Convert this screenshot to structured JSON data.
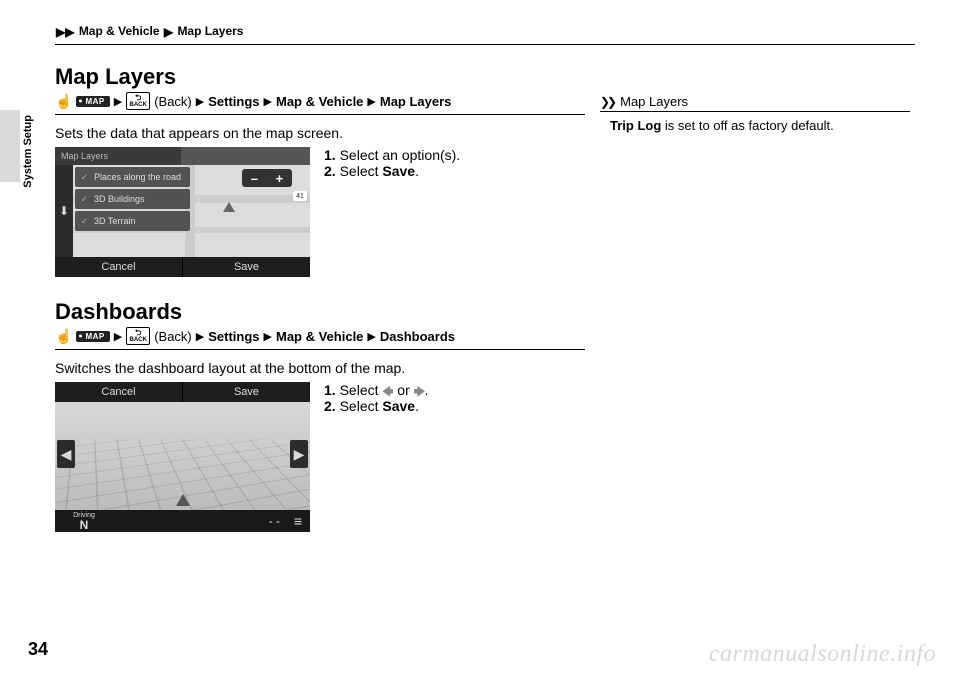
{
  "breadcrumb": {
    "part1": "Map & Vehicle",
    "part2": "Map Layers"
  },
  "side_tab": "System Setup",
  "section1": {
    "title": "Map Layers",
    "path": {
      "map": "MAP",
      "back": "BACK",
      "back_label": "(Back)",
      "p1": "Settings",
      "p2": "Map & Vehicle",
      "p3": "Map Layers"
    },
    "desc": "Sets the data that appears on the map screen.",
    "steps": {
      "s1": "Select an option(s).",
      "s2_a": "Select ",
      "s2_b": "Save",
      "s2_c": "."
    },
    "shot": {
      "header": "Map Layers",
      "items": [
        "Places along the road",
        "3D Buildings",
        "3D Terrain"
      ],
      "zoom_minus": "–",
      "zoom_plus": "+",
      "btn_cancel": "Cancel",
      "btn_save": "Save",
      "badge": "41"
    }
  },
  "section2": {
    "title": "Dashboards",
    "path": {
      "map": "MAP",
      "back": "BACK",
      "back_label": "(Back)",
      "p1": "Settings",
      "p2": "Map & Vehicle",
      "p3": "Dashboards"
    },
    "desc": "Switches the dashboard layout at the bottom of the map.",
    "steps": {
      "s1_a": "Select ",
      "s1_b": " or ",
      "s1_c": ".",
      "s2_a": "Select ",
      "s2_b": "Save",
      "s2_c": "."
    },
    "shot": {
      "btn_cancel": "Cancel",
      "btn_save": "Save",
      "driving_label": "Driving",
      "driving_dir": "N",
      "dash": "- -"
    }
  },
  "sidebar": {
    "title": "Map Layers",
    "body_a": "Trip Log",
    "body_b": " is set to off as factory default."
  },
  "page_number": "34",
  "watermark": "carmanualsonline.info",
  "chart_data": {
    "type": "table",
    "title": "Manual page 34 content summary",
    "sections": [
      {
        "heading": "Map Layers",
        "navigation_path": [
          "MAP",
          "(Back)",
          "Settings",
          "Map & Vehicle",
          "Map Layers"
        ],
        "description": "Sets the data that appears on the map screen.",
        "steps": [
          "Select an option(s).",
          "Select Save."
        ],
        "screenshot_options": [
          "Places along the road",
          "3D Buildings",
          "3D Terrain"
        ],
        "screenshot_buttons": [
          "Cancel",
          "Save"
        ]
      },
      {
        "heading": "Dashboards",
        "navigation_path": [
          "MAP",
          "(Back)",
          "Settings",
          "Map & Vehicle",
          "Dashboards"
        ],
        "description": "Switches the dashboard layout at the bottom of the map.",
        "steps": [
          "Select ◀ or ▶.",
          "Select Save."
        ],
        "screenshot_buttons": [
          "Cancel",
          "Save"
        ],
        "dashboard_indicator": "Driving N"
      }
    ],
    "side_note": "Trip Log is set to off as factory default."
  }
}
